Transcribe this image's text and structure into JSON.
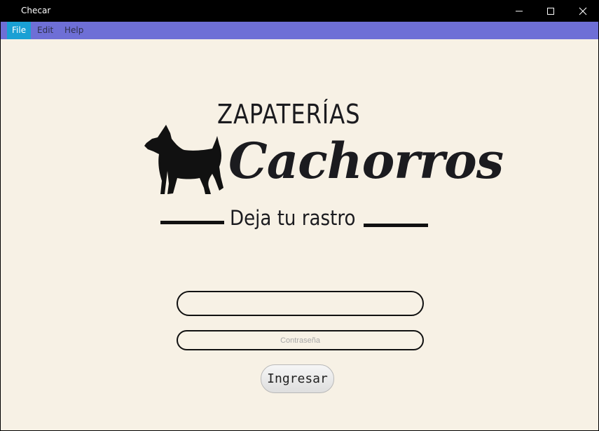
{
  "window": {
    "title": "Checar",
    "controls": {
      "minimize_icon": "minimize-icon",
      "maximize_icon": "maximize-icon",
      "close_icon": "close-icon"
    }
  },
  "menu": {
    "items": [
      {
        "label": "File",
        "active": true
      },
      {
        "label": "Edit",
        "active": false
      },
      {
        "label": "Help",
        "active": false
      }
    ]
  },
  "logo": {
    "top_text": "ZAPATERÍAS",
    "brand": "Cachorros",
    "tagline": "Deja tu rastro",
    "icon": "dog-silhouette-icon"
  },
  "form": {
    "username_value": "",
    "password_placeholder": "Contraseña",
    "submit_label": "Ingresar"
  },
  "colors": {
    "background": "#f7f1e5",
    "titlebar": "#000000",
    "menubar": "#6e6fd6",
    "menu_active": "#1aa0d4"
  }
}
